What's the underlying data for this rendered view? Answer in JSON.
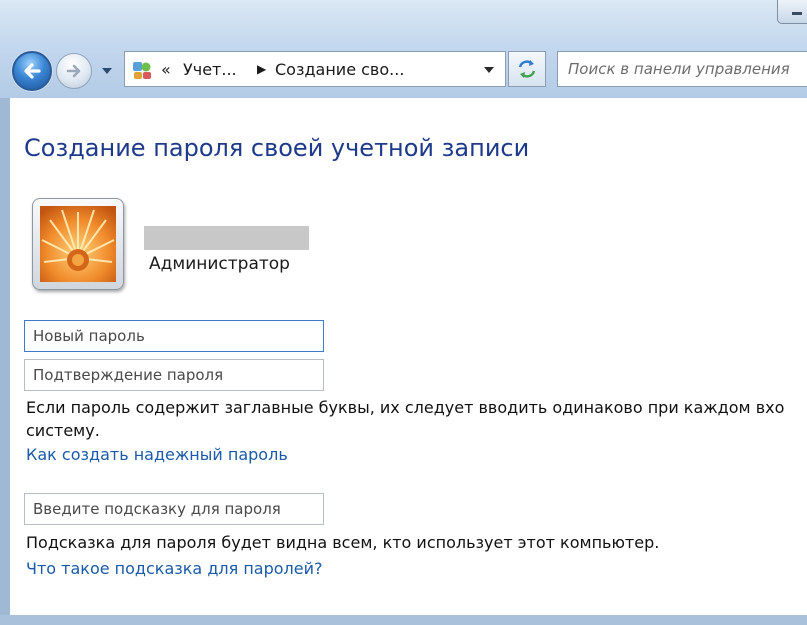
{
  "toolbar": {
    "breadcrumb_prefix": "«",
    "breadcrumb_1": "Учет...",
    "breadcrumb_sep": "▶",
    "breadcrumb_2": "Создание сво...",
    "search_placeholder": "Поиск в панели управления"
  },
  "page": {
    "title": "Создание пароля своей учетной записи",
    "user_role": "Администратор",
    "new_password_placeholder": "Новый пароль",
    "confirm_password_placeholder": "Подтверждение пароля",
    "case_note_line1": "Если пароль содержит заглавные буквы, их следует вводить одинаково при каждом вхо",
    "case_note_line2": "систему.",
    "strong_password_link": "Как создать надежный пароль",
    "hint_placeholder": "Введите подсказку для пароля",
    "hint_note": "Подсказка для пароля будет видна всем, кто использует этот компьютер.",
    "hint_link": "Что такое подсказка для паролей?"
  },
  "colors": {
    "title": "#1e3a8a",
    "link": "#1a5aa8",
    "chrome": "#c4d8ee"
  },
  "icons": {
    "back": "back-arrow-icon",
    "forward": "forward-arrow-icon",
    "recent": "chevron-down-icon",
    "control_panel": "control-panel-icon",
    "refresh": "refresh-icon",
    "avatar": "flower-avatar"
  }
}
